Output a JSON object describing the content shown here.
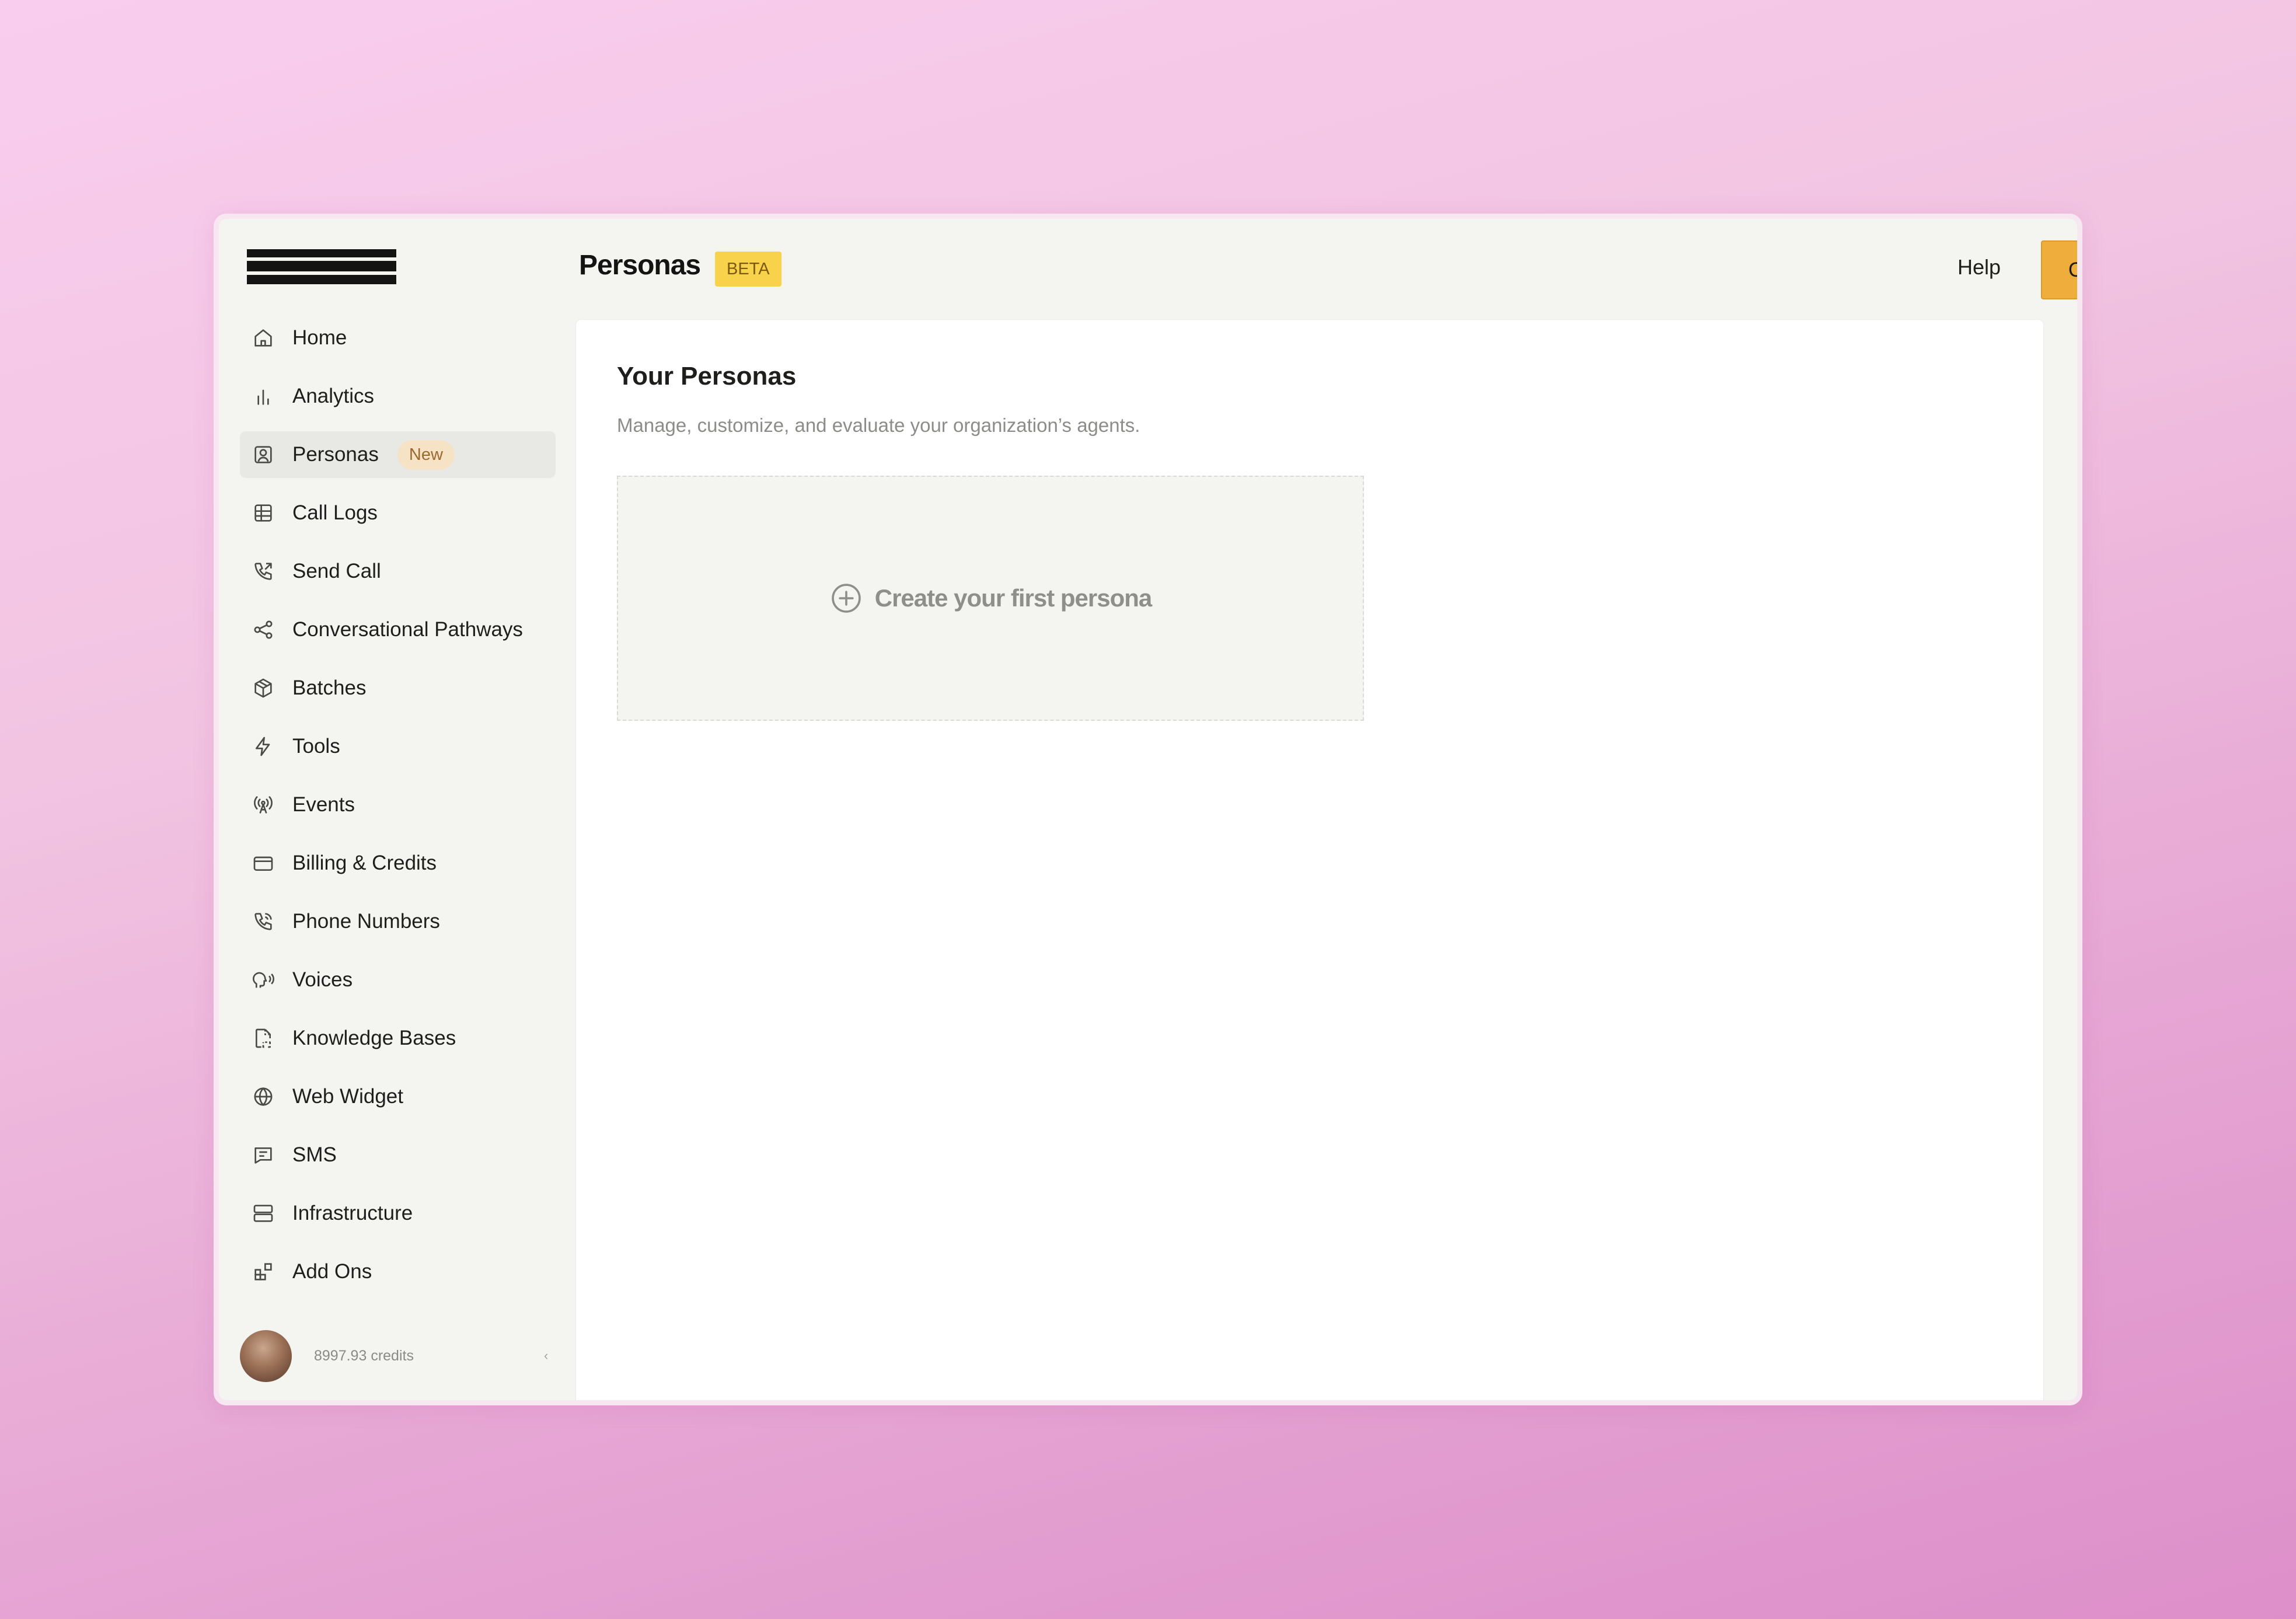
{
  "app": {
    "logo_text": "bland",
    "page_title": "Personas",
    "beta_label": "BETA"
  },
  "header": {
    "help_label": "Help",
    "create_button_label": "Create Persona"
  },
  "sidebar": {
    "items": [
      {
        "label": "Home",
        "icon": "home-icon"
      },
      {
        "label": "Analytics",
        "icon": "bar-chart-icon"
      },
      {
        "label": "Personas",
        "icon": "user-square-icon",
        "active": true,
        "badge": "New"
      },
      {
        "label": "Call Logs",
        "icon": "table-icon"
      },
      {
        "label": "Send Call",
        "icon": "phone-outgoing-icon"
      },
      {
        "label": "Conversational Pathways",
        "icon": "share-icon"
      },
      {
        "label": "Batches",
        "icon": "package-icon"
      },
      {
        "label": "Tools",
        "icon": "lightning-icon"
      },
      {
        "label": "Events",
        "icon": "antenna-icon"
      },
      {
        "label": "Billing & Credits",
        "icon": "credit-card-icon"
      },
      {
        "label": "Phone Numbers",
        "icon": "phone-icon"
      },
      {
        "label": "Voices",
        "icon": "speaking-head-icon"
      },
      {
        "label": "Knowledge Bases",
        "icon": "file-dashed-icon"
      },
      {
        "label": "Web Widget",
        "icon": "globe-icon"
      },
      {
        "label": "SMS",
        "icon": "message-square-icon"
      },
      {
        "label": "Infrastructure",
        "icon": "server-icon"
      },
      {
        "label": "Add Ons",
        "icon": "blocks-icon"
      }
    ],
    "account": {
      "credits_text": "8997.93 credits",
      "collapse_glyph": "‹"
    }
  },
  "main": {
    "section_title": "Your Personas",
    "section_subtitle": "Manage, customize, and evaluate your organization’s agents.",
    "empty_state_label": "Create your first persona"
  },
  "colors": {
    "accent": "#efad3c",
    "beta_badge": "#f7d24a",
    "new_badge_bg": "#f6e2c4",
    "sidebar_bg": "#f4f4f1",
    "active_item_bg": "#e8e8e4"
  }
}
